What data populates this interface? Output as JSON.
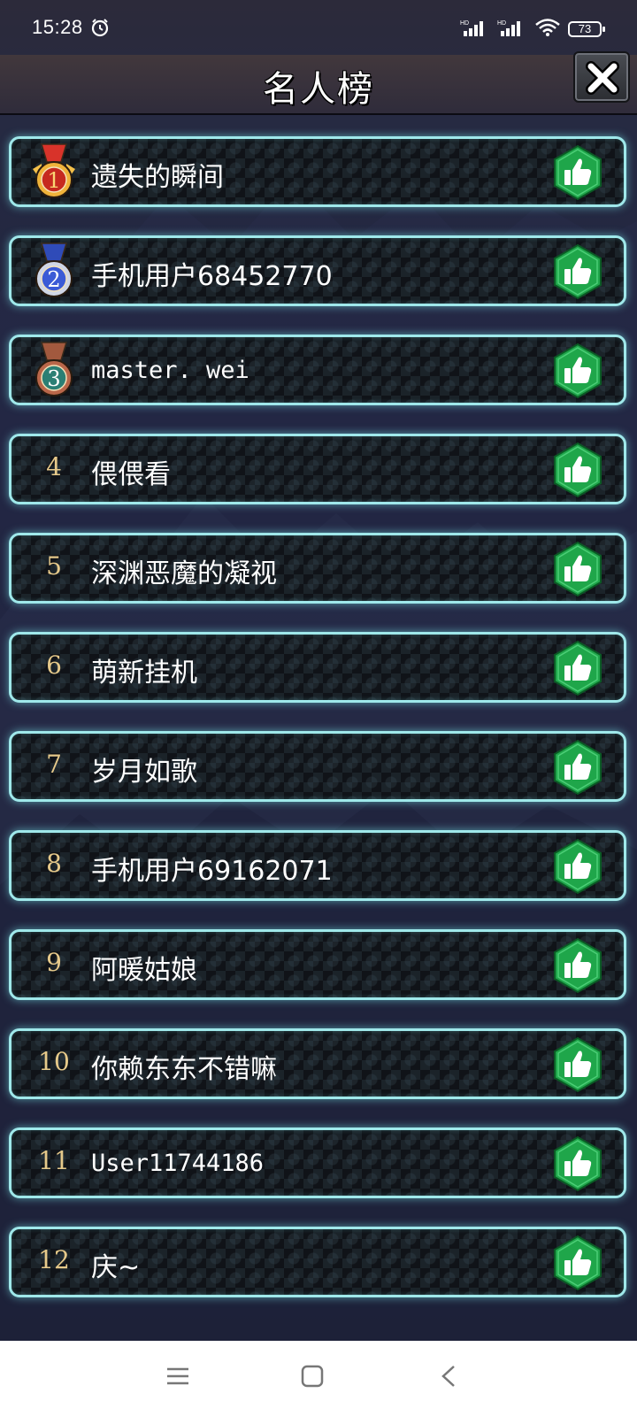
{
  "status_bar": {
    "time": "15:28",
    "battery": "73",
    "icons": [
      "alarm-icon",
      "hd-signal-icon",
      "hd-signal-icon",
      "wifi-icon",
      "battery-icon"
    ]
  },
  "header": {
    "title": "名人榜",
    "close_icon": "close-icon"
  },
  "leaderboard": [
    {
      "rank": "1",
      "name": "遗失的瞬间",
      "badge": "gold-medal"
    },
    {
      "rank": "2",
      "name": "手机用户68452770",
      "badge": "silver-medal"
    },
    {
      "rank": "3",
      "name": "master. wei",
      "badge": "bronze-medal"
    },
    {
      "rank": "4",
      "name": "偎偎看"
    },
    {
      "rank": "5",
      "name": "深渊恶魔的凝视"
    },
    {
      "rank": "6",
      "name": "萌新挂机"
    },
    {
      "rank": "7",
      "name": "岁月如歌"
    },
    {
      "rank": "8",
      "name": "手机用户69162071"
    },
    {
      "rank": "9",
      "name": "阿暖姑娘"
    },
    {
      "rank": "10",
      "name": "你赖东东不错嘛"
    },
    {
      "rank": "11",
      "name": "User11744186"
    },
    {
      "rank": "12",
      "name": "庆~"
    }
  ],
  "like_icon": "thumbs-up-icon",
  "colors": {
    "row_border": "#9fe8ea",
    "rank_text": "#e6c98a",
    "like_green": "#1fa64a",
    "gold": "#f0b33a",
    "silver": "#3b5bd6",
    "bronze": "#b9674a"
  },
  "nav_bar": {
    "buttons": [
      "menu-icon",
      "home-icon",
      "back-icon"
    ]
  }
}
